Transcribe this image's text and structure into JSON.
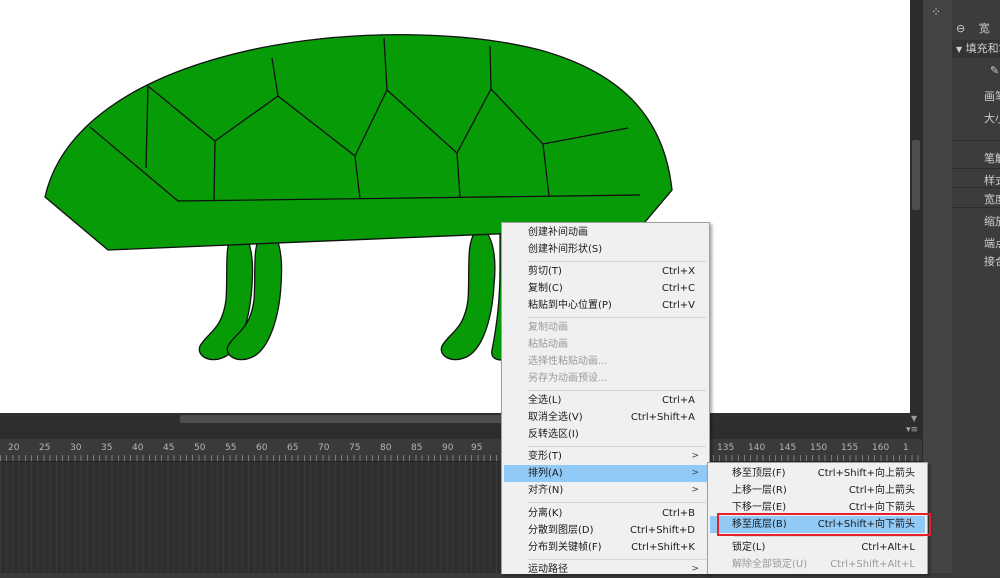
{
  "timeline": {
    "ruler_labels_left": [
      "20",
      "25",
      "30",
      "35",
      "40",
      "45",
      "50",
      "55",
      "60",
      "65",
      "70",
      "75",
      "80",
      "85",
      "90",
      "95"
    ],
    "ruler_labels_right": [
      "135",
      "140",
      "145",
      "150",
      "155",
      "160",
      "1"
    ]
  },
  "properties_panel": {
    "link_label": "宽",
    "section_fill_stroke": "填充和笔",
    "pen_label": "画笔",
    "size_label": "大小",
    "stroke_label": "笔触",
    "style_label": "样式",
    "width_label": "宽度",
    "scale_label": "缩放",
    "cap_label": "端点",
    "join_label": "接合"
  },
  "context_menu": {
    "items": [
      {
        "label": "创建补间动画",
        "shortcut": "",
        "disabled": false
      },
      {
        "label": "创建补间形状(S)",
        "shortcut": "",
        "disabled": false
      },
      {
        "label": "剪切(T)",
        "shortcut": "Ctrl+X",
        "disabled": false
      },
      {
        "label": "复制(C)",
        "shortcut": "Ctrl+C",
        "disabled": false
      },
      {
        "label": "粘贴到中心位置(P)",
        "shortcut": "Ctrl+V",
        "disabled": false
      },
      {
        "label": "复制动画",
        "shortcut": "",
        "disabled": true
      },
      {
        "label": "粘贴动画",
        "shortcut": "",
        "disabled": true
      },
      {
        "label": "选择性粘贴动画...",
        "shortcut": "",
        "disabled": true
      },
      {
        "label": "另存为动画预设...",
        "shortcut": "",
        "disabled": true
      },
      {
        "label": "全选(L)",
        "shortcut": "Ctrl+A",
        "disabled": false
      },
      {
        "label": "取消全选(V)",
        "shortcut": "Ctrl+Shift+A",
        "disabled": false
      },
      {
        "label": "反转选区(I)",
        "shortcut": "",
        "disabled": false
      },
      {
        "label": "变形(T)",
        "shortcut": "",
        "disabled": false
      },
      {
        "label": "排列(A)",
        "shortcut": "",
        "disabled": false
      },
      {
        "label": "对齐(N)",
        "shortcut": "",
        "disabled": false
      },
      {
        "label": "分离(K)",
        "shortcut": "Ctrl+B",
        "disabled": false
      },
      {
        "label": "分散到图层(D)",
        "shortcut": "Ctrl+Shift+D",
        "disabled": false
      },
      {
        "label": "分布到关键帧(F)",
        "shortcut": "Ctrl+Shift+K",
        "disabled": false
      },
      {
        "label": "运动路径",
        "shortcut": "",
        "disabled": false
      }
    ]
  },
  "arrange_submenu": {
    "items": [
      {
        "label": "移至顶层(F)",
        "shortcut": "Ctrl+Shift+向上箭头",
        "disabled": false
      },
      {
        "label": "上移一层(R)",
        "shortcut": "Ctrl+向上箭头",
        "disabled": false
      },
      {
        "label": "下移一层(E)",
        "shortcut": "Ctrl+向下箭头",
        "disabled": false
      },
      {
        "label": "移至底层(B)",
        "shortcut": "Ctrl+Shift+向下箭头",
        "disabled": false
      },
      {
        "label": "锁定(L)",
        "shortcut": "Ctrl+Alt+L",
        "disabled": false
      },
      {
        "label": "解除全部锁定(U)",
        "shortcut": "Ctrl+Shift+Alt+L",
        "disabled": true
      }
    ]
  },
  "colors": {
    "shape_fill": "#079b07",
    "menu_highlight": "#91c9f7",
    "callout_box": "#e3202b"
  }
}
